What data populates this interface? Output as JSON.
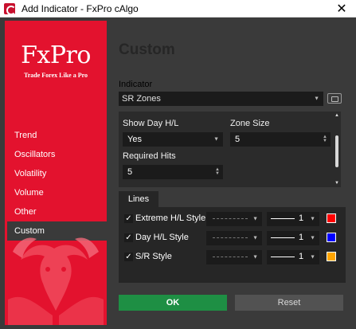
{
  "window": {
    "title": "Add Indicator - FxPro cAlgo",
    "close_glyph": "✕"
  },
  "sidebar": {
    "logo": "FxPro",
    "tagline": "Trade Forex Like a Pro",
    "items": [
      {
        "label": "Trend"
      },
      {
        "label": "Oscillators"
      },
      {
        "label": "Volatility"
      },
      {
        "label": "Volume"
      },
      {
        "label": "Other"
      },
      {
        "label": "Custom",
        "active": true
      }
    ]
  },
  "main": {
    "heading": "Custom",
    "indicator_label": "Indicator",
    "indicator_value": "SR Zones",
    "params": {
      "show_day_hl": {
        "label": "Show Day H/L",
        "value": "Yes"
      },
      "zone_size": {
        "label": "Zone Size",
        "value": "5"
      },
      "required_hits": {
        "label": "Required Hits",
        "value": "5"
      }
    },
    "lines_tab": "Lines",
    "lines": [
      {
        "name": "Extreme H/L Style",
        "checked": true,
        "width": "1",
        "color": "#ff0000"
      },
      {
        "name": "Day H/L Style",
        "checked": true,
        "width": "1",
        "color": "#0000ff"
      },
      {
        "name": "S/R Style",
        "checked": true,
        "width": "1",
        "color": "#ffa500"
      }
    ],
    "ok_label": "OK",
    "reset_label": "Reset"
  },
  "icons": {
    "check": "✓",
    "caret": "▼",
    "spin_up": "▲",
    "spin_down": "▼"
  }
}
